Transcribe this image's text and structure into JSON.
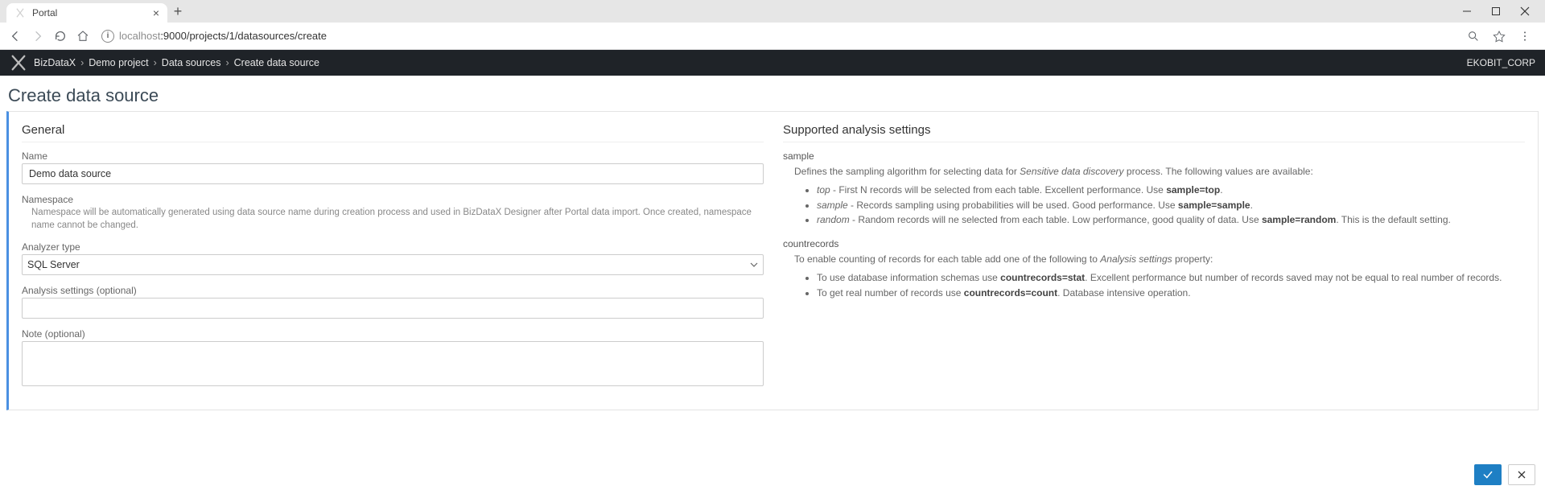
{
  "browser": {
    "tab_title": "Portal",
    "url_host": "localhost",
    "url_path": ":9000/projects/1/datasources/create"
  },
  "header": {
    "crumbs": [
      "BizDataX",
      "Demo project",
      "Data sources",
      "Create data source"
    ],
    "corp": "EKOBIT_CORP"
  },
  "page": {
    "title": "Create data source"
  },
  "general": {
    "title": "General",
    "name_label": "Name",
    "name_value": "Demo data source",
    "namespace_label": "Namespace",
    "namespace_help": "Namespace will be automatically generated using data source name during creation process and used in BizDataX Designer after Portal data import. Once created, namespace name cannot be changed.",
    "analyzer_label": "Analyzer type",
    "analyzer_value": "SQL Server",
    "analysis_label": "Analysis settings (optional)",
    "note_label": "Note (optional)"
  },
  "supported": {
    "title": "Supported analysis settings",
    "sample": {
      "heading": "sample",
      "desc_prefix": "Defines the sampling algorithm for selecting data for ",
      "desc_em": "Sensitive data discovery",
      "desc_suffix": " process. The following values are available:",
      "items": [
        {
          "em": "top",
          "text": " - First N records will be selected from each table. Excellent performance. Use ",
          "bold": "sample=top",
          "tail": "."
        },
        {
          "em": "sample",
          "text": " - Records sampling using probabilities will be used. Good performance. Use ",
          "bold": "sample=sample",
          "tail": "."
        },
        {
          "em": "random",
          "text": " - Random records will ne selected from each table. Low performance, good quality of data. Use ",
          "bold": "sample=random",
          "tail": ". This is the default setting."
        }
      ]
    },
    "countrecords": {
      "heading": "countrecords",
      "desc_prefix": "To enable counting of records for each table add one of the following to ",
      "desc_em": "Analysis settings",
      "desc_suffix": " property:",
      "items": [
        {
          "text": "To use database information schemas  use  ",
          "bold": "countrecords=stat",
          "tail": ". Excellent performance but number of records saved may not be equal to real number of records."
        },
        {
          "text": "To get real number of records use ",
          "bold": "countrecords=count",
          "tail": ". Database intensive operation."
        }
      ]
    }
  }
}
